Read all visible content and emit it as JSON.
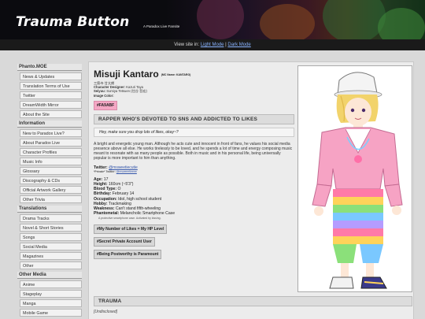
{
  "header": {
    "title": "Trauma Button",
    "subtitle": "A Paradox Live Fansite"
  },
  "viewbar": {
    "prefix": "View site in:",
    "light": "Light Mode",
    "separator": "|",
    "dark": "Dark Mode"
  },
  "sidebar": {
    "sections": [
      {
        "title": "Phanto.MOE",
        "items": [
          "News & Updates",
          "Translation Terms of Use",
          "Twitter",
          "DreamWidth Mirror",
          "About the Site"
        ]
      },
      {
        "title": "Information",
        "items": [
          "New to Paradox Live?",
          "About Paradox Live",
          "Character Profiles",
          "Music Info",
          "Glossary",
          "Discography & CDs",
          "Official Artwork Gallery",
          "Other Trivia"
        ]
      },
      {
        "title": "Translations",
        "items": [
          "Drama Tracks",
          "Novel & Short Stories",
          "Songs",
          "Social Media",
          "Magazines",
          "Other"
        ]
      },
      {
        "title": "Other Media",
        "items": [
          "Anime",
          "Stageplay",
          "Manga",
          "Mobile Game"
        ]
      }
    ]
  },
  "profile": {
    "name": "Misuji Kantaro",
    "nickname": "(MC Name: KANTARO)",
    "japanese": "三筋寺 甘太朗",
    "designer_label": "Character Designer:",
    "designer": "Kazuri Taya",
    "seiyuu_label": "Seiyuu:",
    "seiyuu": "Sumiya Tetsuen (住谷 哲宏)",
    "color_label": "Image Color:",
    "color_code": "#FA9ABF",
    "tagline": "RAPPER WHO'S DEVOTED TO SNS AND ADDICTED TO LIKES",
    "quote": "Hey, make sure you drop lots of likes, okay~?",
    "description": "A bright and energetic young man. Although he acts cute and innocent in front of fans, he values his social media presence above all else. He works tirelessly to be loved, and he spends a lot of time and energy composing music meant to resonate with as many people as possible. Both in music and in his personal life, being universally popular is more important to him than anything.",
    "twitter_label": "Twitter:",
    "twitter_handle": "@msweetiecutie",
    "twitter_private_label": "*Private* Twitter:",
    "twitter_private": "@msweeetieeee",
    "stats": [
      {
        "label": "Age:",
        "value": "17"
      },
      {
        "label": "Height:",
        "value": "160cm (~5'3\")"
      },
      {
        "label": "Blood Type:",
        "value": "O"
      },
      {
        "label": "Birthday:",
        "value": "February 14"
      },
      {
        "label": "Occupation:",
        "value": "Idol, high school student"
      },
      {
        "label": "Hobby:",
        "value": "Trackmaking"
      },
      {
        "label": "Weakness:",
        "value": "Can't stand fifth-wheeling"
      },
      {
        "label": "Phantometal:",
        "value": "Melancholic Smartphone Case"
      }
    ],
    "phantometal_note": "A protective smartphone case. Activated by kissing.",
    "abilities": [
      "#My Number of Likes = My HP Level",
      "#Secret Private Account User",
      "#Being Postworthy is Paramount"
    ],
    "trauma_title": "TRAUMA",
    "trauma_value": "[Undisclosed]"
  },
  "colors": {
    "image_color": "#FA9ABF",
    "link": "#8ab4ff"
  }
}
